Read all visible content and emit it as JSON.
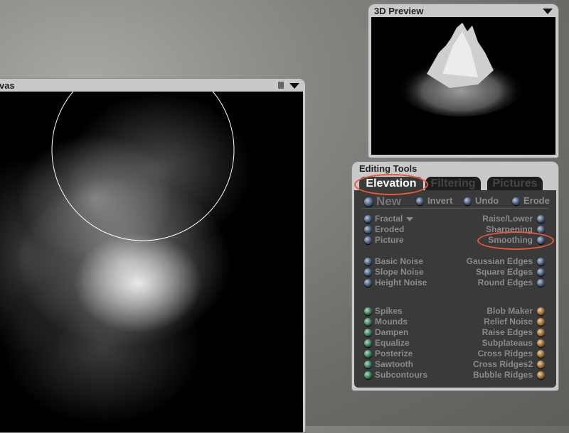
{
  "canvas": {
    "title": "vas"
  },
  "preview": {
    "title": "3D Preview"
  },
  "tools": {
    "title": "Editing Tools",
    "tabs": [
      {
        "label": "Elevation",
        "active": true
      },
      {
        "label": "Filtering"
      },
      {
        "label": "Pictures"
      }
    ],
    "top_row": [
      "New",
      "Invert",
      "Undo",
      "Erode"
    ],
    "left": [
      {
        "label": "Fractal",
        "color": "blue"
      },
      {
        "label": "Eroded",
        "color": "blue"
      },
      {
        "label": "Picture",
        "color": "blue"
      },
      {
        "label": "Basic Noise",
        "color": "blue"
      },
      {
        "label": "Slope Noise",
        "color": "blue"
      },
      {
        "label": "Height Noise",
        "color": "blue"
      },
      {
        "label": "Spikes",
        "color": "green"
      },
      {
        "label": "Mounds",
        "color": "green"
      },
      {
        "label": "Dampen",
        "color": "green"
      },
      {
        "label": "Equalize",
        "color": "green"
      },
      {
        "label": "Posterize",
        "color": "green"
      },
      {
        "label": "Sawtooth",
        "color": "green"
      },
      {
        "label": "Subcontours",
        "color": "green"
      }
    ],
    "right": [
      {
        "label": "Raise/Lower",
        "color": "blue"
      },
      {
        "label": "Sharpening",
        "color": "blue"
      },
      {
        "label": "Smoothing",
        "color": "blue"
      },
      {
        "label": "Gaussian Edges",
        "color": "blue"
      },
      {
        "label": "Square Edges",
        "color": "blue"
      },
      {
        "label": "Round Edges",
        "color": "blue"
      },
      {
        "label": "Blob Maker",
        "color": "orange"
      },
      {
        "label": "Relief Noise",
        "color": "orange"
      },
      {
        "label": "Raise Edges",
        "color": "orange"
      },
      {
        "label": "Subplateaus",
        "color": "orange"
      },
      {
        "label": "Cross Ridges",
        "color": "orange"
      },
      {
        "label": "Cross Ridges2",
        "color": "orange"
      },
      {
        "label": "Bubble Ridges",
        "color": "orange"
      }
    ]
  },
  "colors": {
    "highlight": "#e8573a"
  }
}
